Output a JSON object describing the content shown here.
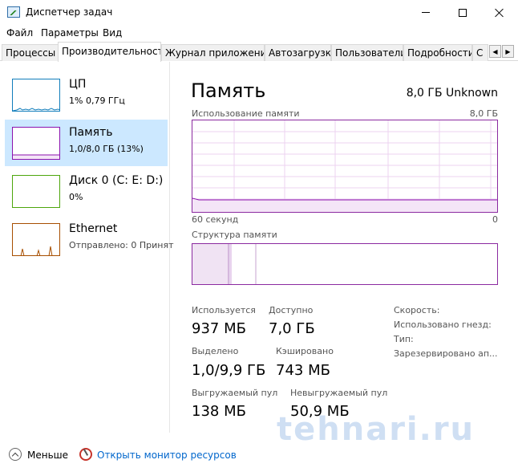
{
  "window": {
    "title": "Диспетчер задач"
  },
  "menu": [
    "Файл",
    "Параметры",
    "Вид"
  ],
  "tabs": [
    {
      "label": "Процессы"
    },
    {
      "label": "Производительность"
    },
    {
      "label": "Журнал приложений"
    },
    {
      "label": "Автозагрузка"
    },
    {
      "label": "Пользователи"
    },
    {
      "label": "Подробности"
    },
    {
      "label": "С"
    }
  ],
  "active_tab": "Производительность",
  "resources": [
    {
      "name": "ЦП",
      "sub": "1% 0,79 ГГц",
      "color": "#117dbb"
    },
    {
      "name": "Память",
      "sub": "1,0/8,0 ГБ (13%)",
      "color": "#8b12ae"
    },
    {
      "name": "Диск 0 (C: E: D:)",
      "sub": "0%",
      "color": "#4da60c"
    },
    {
      "name": "Ethernet",
      "sub": "Отправлено: 0 Принят",
      "color": "#a74f01"
    }
  ],
  "memory": {
    "title": "Память",
    "total": "8,0 ГБ Unknown",
    "usage_caption": "Использование памяти",
    "usage_max": "8,0 ГБ",
    "time_left": "60 секунд",
    "time_right": "0",
    "usage_level_percent": 13,
    "composition_caption": "Структура памяти",
    "stats": {
      "in_use_label": "Используется",
      "in_use_value": "937 МБ",
      "available_label": "Доступно",
      "available_value": "7,0 ГБ",
      "committed_label": "Выделено",
      "committed_value": "1,0/9,9 ГБ",
      "cached_label": "Кэшировано",
      "cached_value": "743 МБ",
      "paged_label": "Выгружаемый пул",
      "paged_value": "138 МБ",
      "nonpaged_label": "Невыгружаемый пул",
      "nonpaged_value": "50,9 МБ"
    },
    "side": {
      "speed": "Скорость:",
      "slots": "Использовано гнезд:",
      "form": "Тип:",
      "reserved": "Зарезервировано ап..."
    }
  },
  "footer": {
    "less": "Меньше",
    "monitor": "Открыть монитор ресурсов"
  },
  "watermark": "tehnari.ru",
  "colors": {
    "accent": "#8b12ae",
    "selected_bg": "#cce8ff",
    "link": "#0066cc"
  }
}
